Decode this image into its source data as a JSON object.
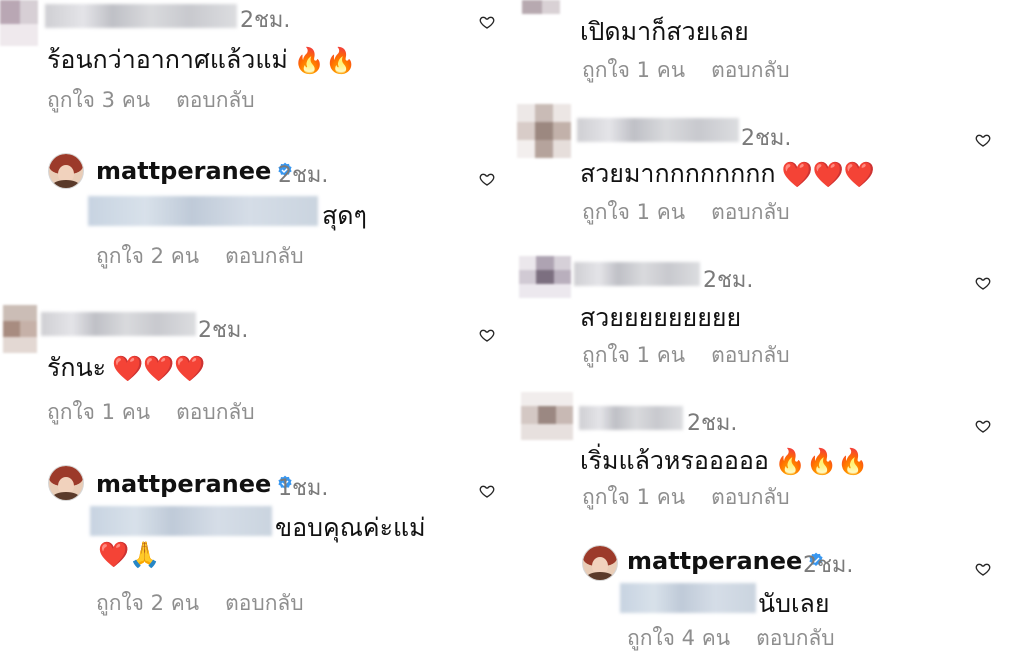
{
  "labels": {
    "like_prefix": "ถูกใจ",
    "reply": "ตอบกลับ"
  },
  "left": [
    {
      "time": "2ชม.",
      "text": "ร้อนกว่าอากาศแล้วแม่",
      "emoji": "🔥🔥",
      "likes": "ถูกใจ 3 คน",
      "reply": "ตอบกลับ"
    },
    {
      "username": "mattperanee",
      "time": "2ชม.",
      "text": "สุดๆ",
      "likes": "ถูกใจ 2 คน",
      "reply": "ตอบกลับ"
    },
    {
      "time": "2ชม.",
      "text": "รักนะ",
      "emoji": "❤️❤️❤️",
      "likes": "ถูกใจ 1 คน",
      "reply": "ตอบกลับ"
    },
    {
      "username": "mattperanee",
      "time": "1ชม.",
      "text": "ขอบคุณค่ะแม่",
      "emoji": "❤️🙏",
      "likes": "ถูกใจ 2 คน",
      "reply": "ตอบกลับ"
    }
  ],
  "right": [
    {
      "text": "เปิดมาก็สวยเลย",
      "likes": "ถูกใจ 1 คน",
      "reply": "ตอบกลับ"
    },
    {
      "time": "2ชม.",
      "text": "สวยมากกกกกกกก",
      "emoji": "❤️❤️❤️",
      "likes": "ถูกใจ 1 คน",
      "reply": "ตอบกลับ"
    },
    {
      "time": "2ชม.",
      "text": "สวยยยยยยยยย",
      "likes": "ถูกใจ 1 คน",
      "reply": "ตอบกลับ"
    },
    {
      "time": "2ชม.",
      "text": "เริ่มแล้วหรอออออ",
      "emoji": "🔥🔥🔥",
      "likes": "ถูกใจ 1 คน",
      "reply": "ตอบกลับ"
    },
    {
      "username": "mattperanee",
      "time": "2ชม.",
      "text": "นับเลย",
      "likes": "ถูกใจ 4 คน",
      "reply": "ตอบกลับ"
    }
  ],
  "colors": {
    "verified": "#3897f0",
    "meta": "#8e8e8e",
    "heart_outline": "#262626"
  },
  "icons": {
    "like": "heart-outline-icon",
    "verified": "verified-badge-icon"
  }
}
